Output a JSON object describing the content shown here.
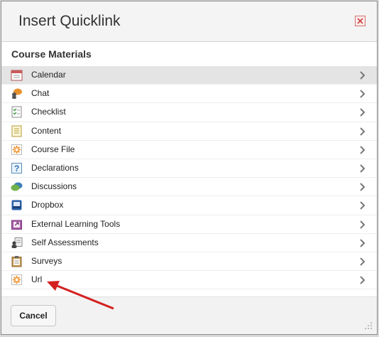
{
  "dialog": {
    "title": "Insert Quicklink",
    "section_title": "Course Materials",
    "items": [
      {
        "label": "Calendar",
        "icon": "calendar-icon",
        "selected": true
      },
      {
        "label": "Chat",
        "icon": "chat-icon"
      },
      {
        "label": "Checklist",
        "icon": "checklist-icon"
      },
      {
        "label": "Content",
        "icon": "content-icon"
      },
      {
        "label": "Course File",
        "icon": "course-file-icon"
      },
      {
        "label": "Declarations",
        "icon": "declarations-icon"
      },
      {
        "label": "Discussions",
        "icon": "discussions-icon"
      },
      {
        "label": "Dropbox",
        "icon": "dropbox-icon"
      },
      {
        "label": "External Learning Tools",
        "icon": "external-tools-icon"
      },
      {
        "label": "Self Assessments",
        "icon": "self-assessments-icon"
      },
      {
        "label": "Surveys",
        "icon": "surveys-icon"
      },
      {
        "label": "Url",
        "icon": "url-icon"
      }
    ],
    "cancel_label": "Cancel"
  },
  "colors": {
    "selected_row": "#e4e4e4",
    "annotation_arrow": "#d42020"
  }
}
